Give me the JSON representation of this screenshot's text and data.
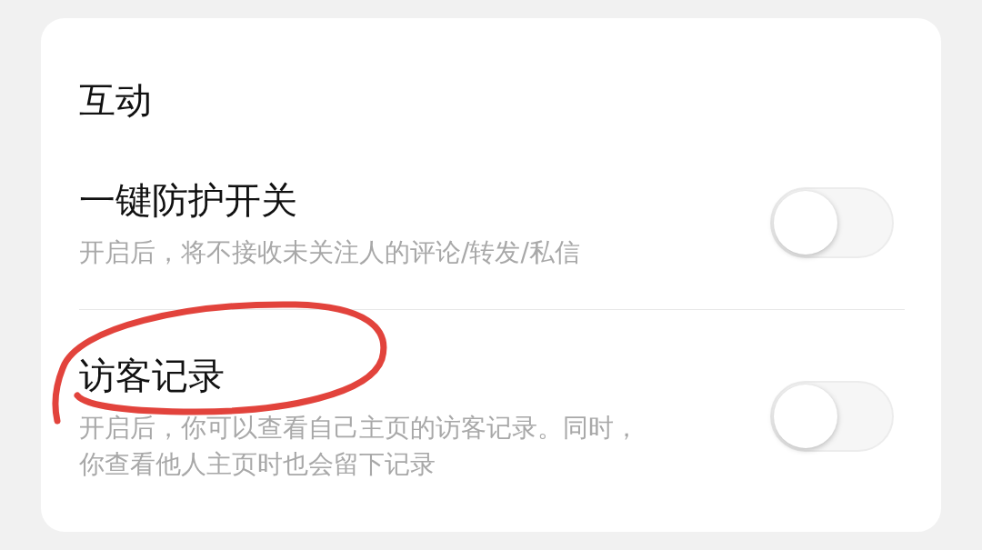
{
  "section": {
    "title": "互动"
  },
  "rows": [
    {
      "title": "一键防护开关",
      "description": "开启后，将不接收未关注人的评论/转发/私信",
      "on": false
    },
    {
      "title": "访客记录",
      "description": "开启后，你可以查看自己主页的访客记录。同时，你查看他人主页时也会留下记录",
      "on": false
    }
  ]
}
